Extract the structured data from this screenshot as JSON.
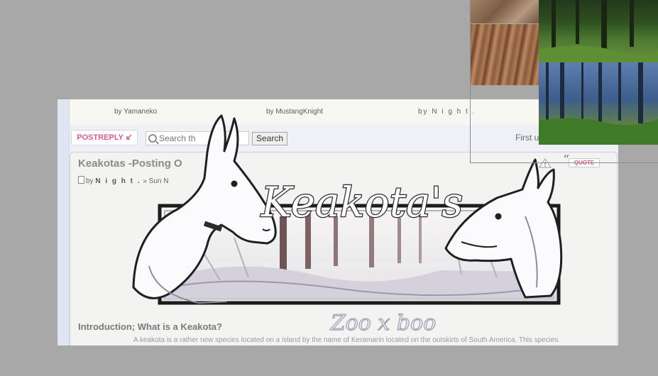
{
  "topic_authors": [
    "by Yamaneko",
    "by MustangKnight",
    "by N i g h t ."
  ],
  "toolbar": {
    "post_reply_label": "POSTREPLY",
    "search_placeholder": "Search th",
    "search_button_label": "Search",
    "first_unread_label": "First u"
  },
  "post": {
    "title": "Keakotas -Posting O",
    "meta_prefix": "by",
    "meta_author": "N i g h t .",
    "meta_date": "» Sun N",
    "quote_label": "QUOTE",
    "intro_heading": "Introduction; What is a Keakota?",
    "intro_text": "A keakota is a rather new species located on a island by the name of Keramarin located on the outskirts of South America. This species"
  },
  "banner": {
    "title": "Keakota's",
    "signature": "Zoo x boo"
  },
  "colors": {
    "page_background": "#a8a8a8",
    "accent_pink": "#d35d8a",
    "panel_border": "#c9d2de",
    "forest_green": "#3d6b2a",
    "forest_blue": "#4d6f9e"
  },
  "icons": [
    "search-icon",
    "reply-arrow-icon",
    "post-document-icon",
    "report-icon",
    "quote-mark-icon"
  ]
}
